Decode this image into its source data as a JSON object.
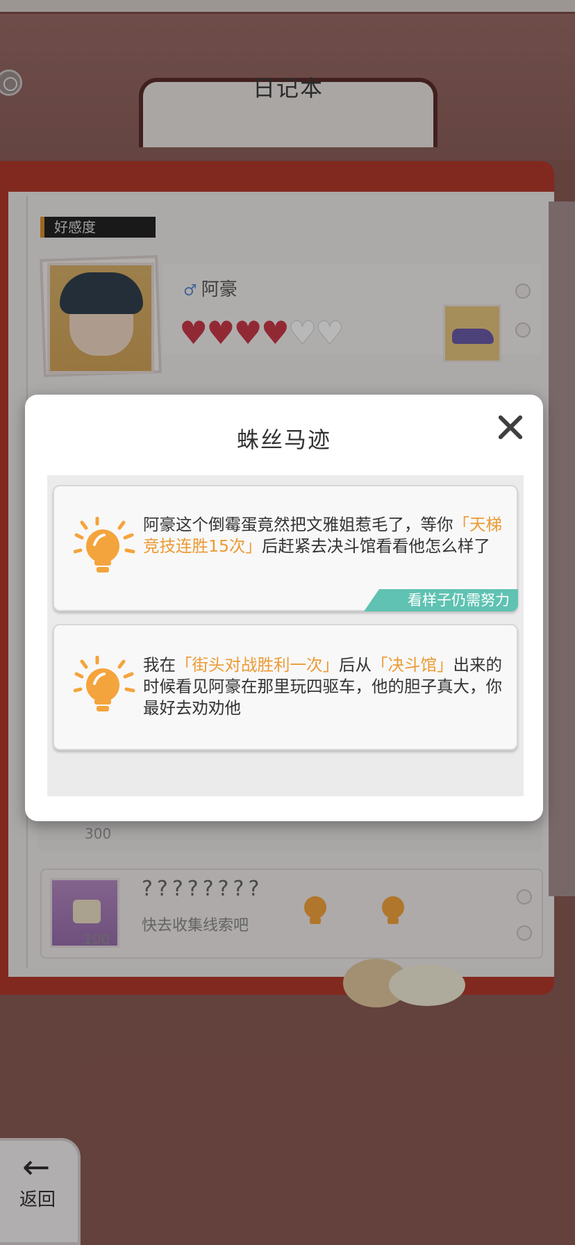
{
  "notebook": {
    "title": "日记本",
    "affinity_tag": "好感度"
  },
  "character": {
    "name": "阿豪",
    "gender_symbol": "♂",
    "hearts_full": 4,
    "hearts_total": 6,
    "heart_colors": {
      "full": "#c93a4a",
      "empty": "#ffffff"
    }
  },
  "hidden_row": {
    "count": "300"
  },
  "secret_row": {
    "title": "????????",
    "subtitle": "快去收集线索吧",
    "count": "100"
  },
  "back_button": {
    "arrow": "←",
    "label": "返回"
  },
  "modal": {
    "title": "蛛丝马迹",
    "close_icon": "close-icon",
    "clues": [
      {
        "icon": "lightbulb-icon",
        "segments": [
          {
            "text": "阿豪这个倒霉蛋竟然把文雅姐惹毛了，等你",
            "highlight": false
          },
          {
            "text": "「天梯竞技连胜15次」",
            "highlight": true
          },
          {
            "text": "后赶紧去决斗馆看看他怎么样了",
            "highlight": false
          }
        ],
        "badge": "看样子仍需努力"
      },
      {
        "icon": "lightbulb-icon",
        "segments": [
          {
            "text": "我在",
            "highlight": false
          },
          {
            "text": "「街头对战胜利一次」",
            "highlight": true
          },
          {
            "text": "后从",
            "highlight": false
          },
          {
            "text": "「决斗馆」",
            "highlight": true
          },
          {
            "text": "出来的时候看见阿豪在那里玩四驱车，他的胆子真大，你最好去劝劝他",
            "highlight": false
          }
        ]
      }
    ]
  },
  "colors": {
    "frame_red": "#b33a2c",
    "highlight_orange": "#eb9a34",
    "badge_teal": "#5fc2b2",
    "bulb_orange": "#f4a43c"
  }
}
